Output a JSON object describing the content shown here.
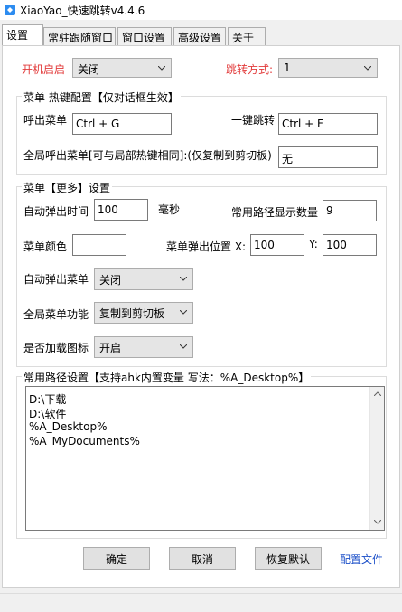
{
  "window": {
    "title": "XiaoYao_快速跳转v4.4.6"
  },
  "tabs": [
    {
      "label": "设置"
    },
    {
      "label": "常驻跟随窗口"
    },
    {
      "label": "窗口设置"
    },
    {
      "label": "高级设置"
    },
    {
      "label": "关于"
    }
  ],
  "general": {
    "autostart_label": "开机启启",
    "autostart_value": "关闭",
    "jump_mode_label": "跳转方式:",
    "jump_mode_value": "1"
  },
  "hotkeys": {
    "title": "菜单 热键配置【仅对话框生效】",
    "call_menu_label": "呼出菜单",
    "call_menu_value": "Ctrl + G",
    "one_key_label": "一键跳转",
    "one_key_value": "Ctrl + F",
    "global_label": "全局呼出菜单[可与局部热键相同]:(仅复制到剪切板)",
    "global_value": "无"
  },
  "more": {
    "title": "菜单【更多】设置",
    "auto_popup_time_label": "自动弹出时间",
    "auto_popup_time_value": "100",
    "ms_label": "毫秒",
    "path_count_label": "常用路径显示数量",
    "path_count_value": "9",
    "menu_color_label": "菜单颜色",
    "menu_color_value": "",
    "popup_pos_label": "菜单弹出位置 X:",
    "popup_x_value": "100",
    "y_label": "Y:",
    "popup_y_value": "100",
    "auto_popup_label": "自动弹出菜单",
    "auto_popup_value": "关闭",
    "global_func_label": "全局菜单功能",
    "global_func_value": "复制到剪切板",
    "load_icon_label": "是否加载图标",
    "load_icon_value": "开启"
  },
  "paths": {
    "title": "常用路径设置【支持ahk内置变量 写法：%A_Desktop%】",
    "lines": [
      "D:\\下载",
      "D:\\软件",
      "%A_Desktop%",
      "%A_MyDocuments%"
    ]
  },
  "buttons": {
    "ok": "确定",
    "cancel": "取消",
    "reset": "恢复默认",
    "config_link": "配置文件"
  },
  "colors": {
    "accent_red": "#e23b3b",
    "link_blue": "#1a4ec8"
  }
}
